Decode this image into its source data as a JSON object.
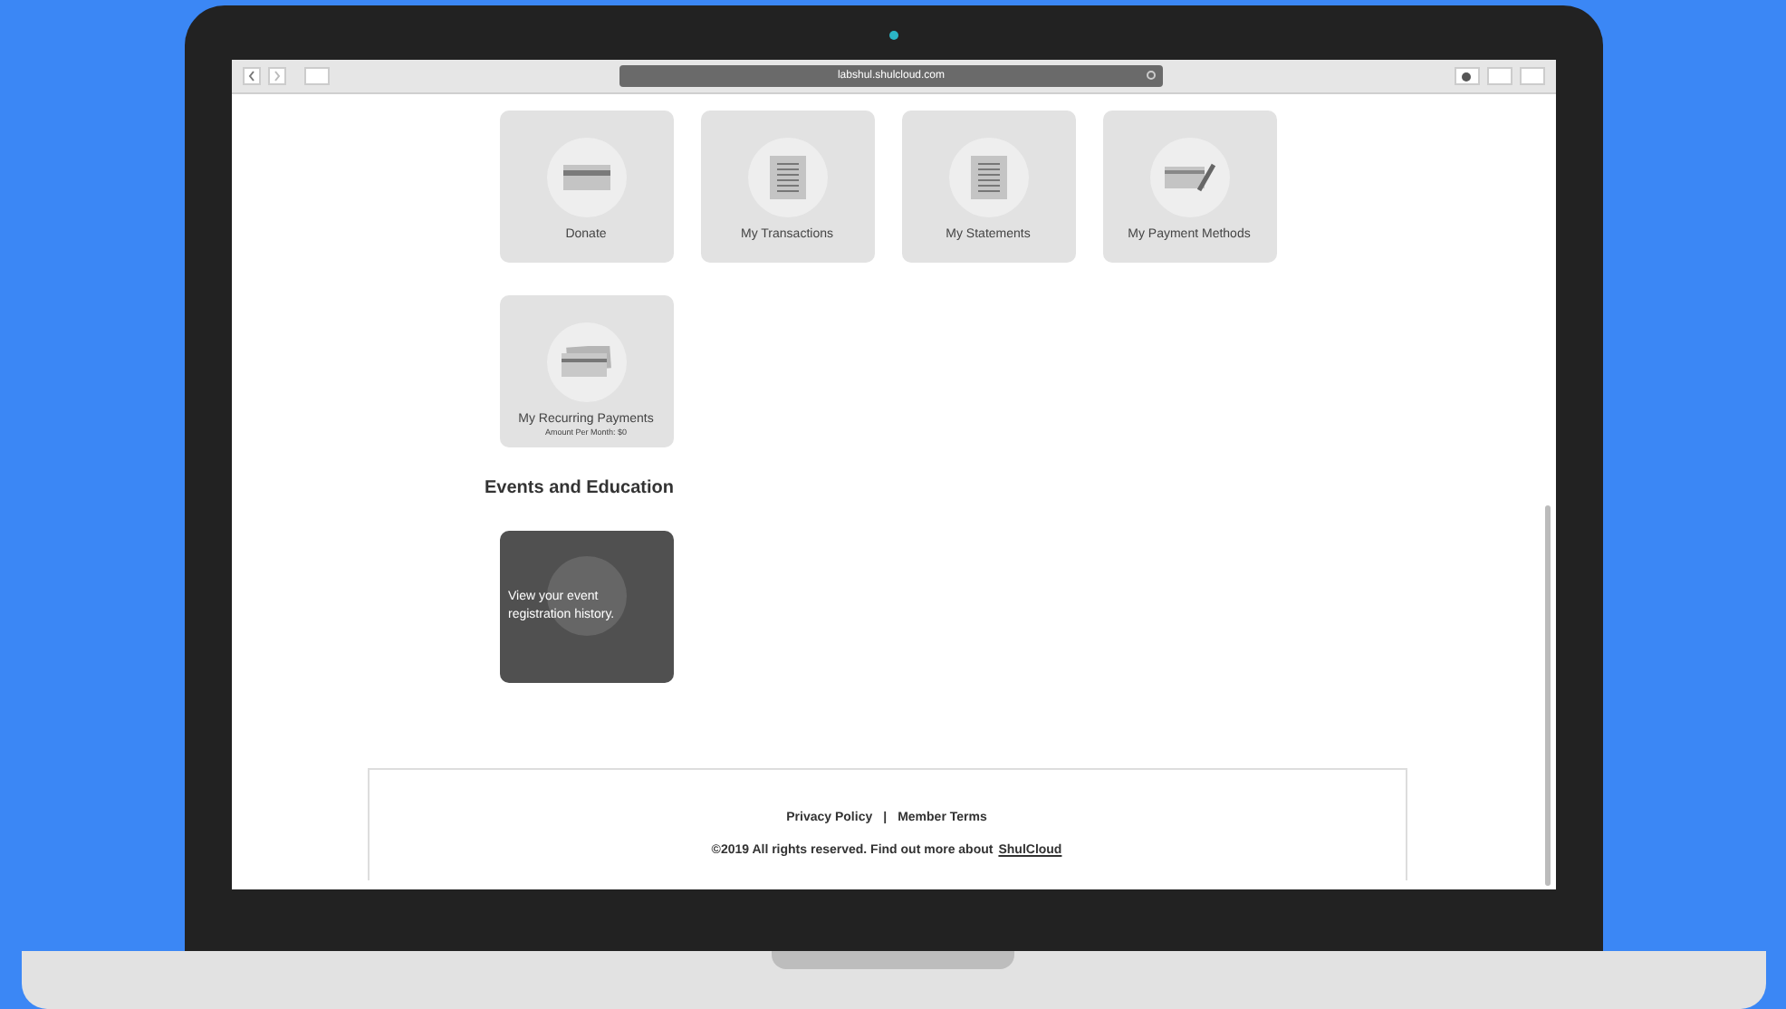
{
  "browser": {
    "url": "labshul.shulcloud.com"
  },
  "tiles": [
    {
      "label": "Donate",
      "kind": "card"
    },
    {
      "label": "My Transactions",
      "kind": "document"
    },
    {
      "label": "My Statements",
      "kind": "document"
    },
    {
      "label": "My Payment Methods",
      "kind": "cardpen"
    },
    {
      "label": "My Recurring Payments",
      "kind": "cards",
      "sublabel": "Amount Per Month: $0"
    }
  ],
  "events": {
    "title": "Events and Education",
    "tiles": [
      {
        "text": "View your event registration history."
      }
    ]
  },
  "footer": {
    "links": [
      "Privacy Policy",
      "Member Terms"
    ],
    "separator": "|",
    "copyright": "©2019 All rights reserved. Find out more about",
    "link": "ShulCloud"
  }
}
